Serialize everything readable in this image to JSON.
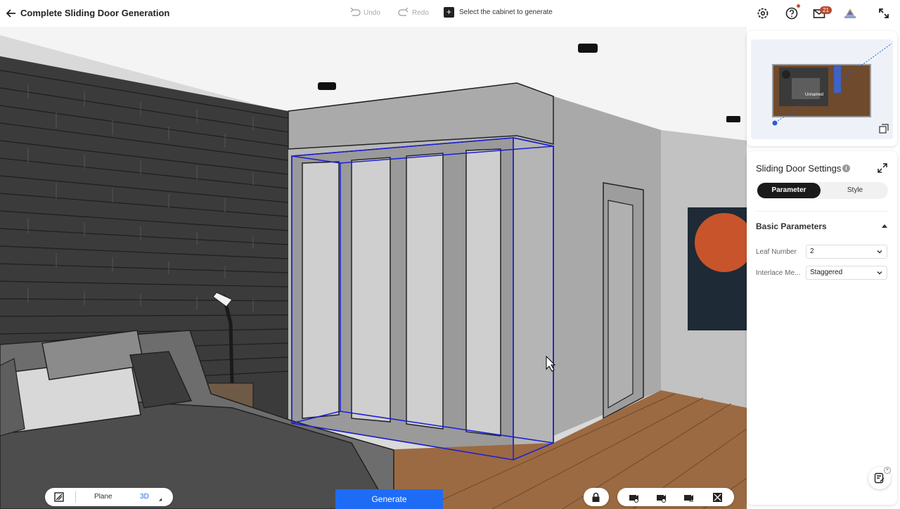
{
  "header": {
    "title": "Complete Sliding Door Generation",
    "undo_label": "Undo",
    "redo_label": "Redo",
    "hint": "Select the cabinet to generate",
    "mail_count": "21"
  },
  "minimap": {
    "room_label": "Unnamed"
  },
  "settings": {
    "title": "Sliding Door Settings",
    "tabs": [
      {
        "label": "Parameter",
        "active": true
      },
      {
        "label": "Style",
        "active": false
      }
    ],
    "section_title": "Basic Parameters",
    "fields": [
      {
        "label": "Leaf Number",
        "value": "2"
      },
      {
        "label": "Interlace Me...",
        "value": "Staggered"
      }
    ]
  },
  "bottom": {
    "plane_label": "Plane",
    "three_d_label": "3D",
    "generate_label": "Generate"
  },
  "icons": {
    "back": "arrow-left-icon",
    "settings": "gear-icon",
    "help": "question-icon",
    "mail": "mail-icon",
    "fullscreen": "fullscreen-icon"
  },
  "colors": {
    "accent": "#1e6cf5",
    "selection": "#1a1fd6",
    "badge": "#b64b2e"
  }
}
